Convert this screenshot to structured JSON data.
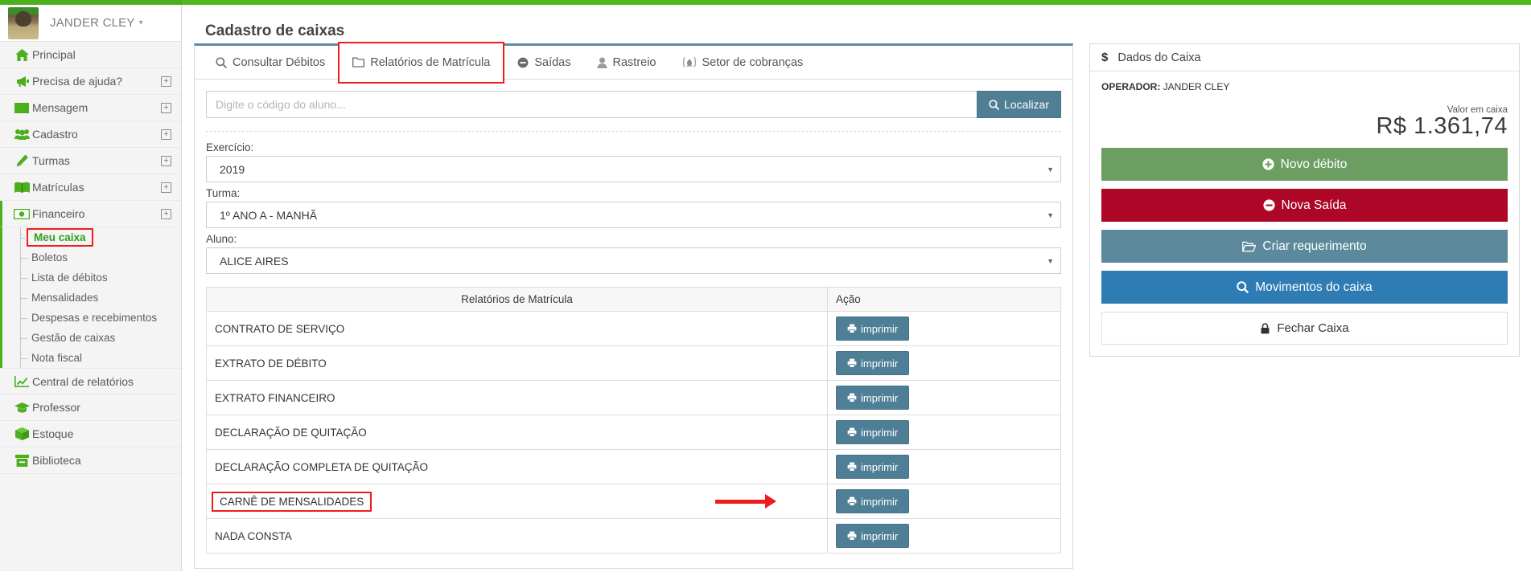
{
  "sidebar": {
    "user": {
      "name": "JANDER CLEY",
      "caret": "caret-down-icon"
    },
    "items": [
      {
        "label": "Principal",
        "icon": "home-icon",
        "expandable": false
      },
      {
        "label": "Precisa de ajuda?",
        "icon": "megaphone-icon",
        "expandable": true
      },
      {
        "label": "Mensagem",
        "icon": "envelope-icon",
        "expandable": true
      },
      {
        "label": "Cadastro",
        "icon": "users-icon",
        "expandable": true
      },
      {
        "label": "Turmas",
        "icon": "pencil-icon",
        "expandable": true
      },
      {
        "label": "Matrículas",
        "icon": "book-icon",
        "expandable": true
      },
      {
        "label": "Financeiro",
        "icon": "money-icon",
        "expandable": true,
        "active": true
      },
      {
        "label": "Central de relatórios",
        "icon": "chart-line-icon",
        "expandable": false
      },
      {
        "label": "Professor",
        "icon": "graduation-icon",
        "expandable": false
      },
      {
        "label": "Estoque",
        "icon": "box-icon",
        "expandable": false
      },
      {
        "label": "Biblioteca",
        "icon": "archive-icon",
        "expandable": false
      }
    ],
    "financeiro_children": [
      {
        "label": "Meu caixa",
        "highlighted": true
      },
      {
        "label": "Boletos",
        "highlighted": false
      },
      {
        "label": "Lista de débitos",
        "highlighted": false
      },
      {
        "label": "Mensalidades",
        "highlighted": false
      },
      {
        "label": "Despesas e recebimentos",
        "highlighted": false
      },
      {
        "label": "Gestão de caixas",
        "highlighted": false
      },
      {
        "label": "Nota fiscal",
        "highlighted": false
      }
    ],
    "expand_glyph": "+"
  },
  "page": {
    "title": "Cadastro de caixas"
  },
  "tabs": [
    {
      "label": "Consultar Débitos",
      "icon": "search-icon",
      "active": false,
      "highlighted": false
    },
    {
      "label": "Relatórios de Matrícula",
      "icon": "folder-icon",
      "active": true,
      "highlighted": true
    },
    {
      "label": "Saídas",
      "icon": "minus-circle-icon",
      "active": false,
      "highlighted": false
    },
    {
      "label": "Rastreio",
      "icon": "user-icon",
      "active": false,
      "highlighted": false
    },
    {
      "label": "Setor de cobranças",
      "icon": "fire-icon",
      "active": false,
      "highlighted": false
    }
  ],
  "search": {
    "placeholder": "Digite o código do aluno...",
    "value": "",
    "button_label": "Localizar",
    "button_icon": "search-icon"
  },
  "filters": [
    {
      "label": "Exercício:",
      "value": "2019",
      "name": "exercicio"
    },
    {
      "label": "Turma:",
      "value": "1º ANO A - MANHÃ",
      "name": "turma"
    },
    {
      "label": "Aluno:",
      "value": "ALICE AIRES",
      "name": "aluno"
    }
  ],
  "table": {
    "headers": {
      "name": "Relatórios de Matrícula",
      "action": "Ação"
    },
    "print_label": "imprimir",
    "print_icon": "printer-icon",
    "rows": [
      {
        "name": "CONTRATO DE SERVIÇO",
        "highlighted": false,
        "arrow": false
      },
      {
        "name": "EXTRATO DE DÉBITO",
        "highlighted": false,
        "arrow": false
      },
      {
        "name": "EXTRATO FINANCEIRO",
        "highlighted": false,
        "arrow": false
      },
      {
        "name": "DECLARAÇÃO DE QUITAÇÃO",
        "highlighted": false,
        "arrow": false
      },
      {
        "name": "DECLARAÇÃO COMPLETA DE QUITAÇÃO",
        "highlighted": false,
        "arrow": false
      },
      {
        "name": "CARNÊ DE MENSALIDADES",
        "highlighted": true,
        "arrow": true
      },
      {
        "name": "NADA CONSTA",
        "highlighted": false,
        "arrow": false
      }
    ]
  },
  "cash_panel": {
    "icon": "dollar-icon",
    "title": "Dados do Caixa",
    "operator_label": "OPERADOR:",
    "operator_name": " JANDER CLEY",
    "balance_label": "Valor em caixa",
    "balance_value": "R$ 1.361,74",
    "buttons": [
      {
        "label": "Novo débito",
        "icon": "plus-circle-icon",
        "style": "green"
      },
      {
        "label": "Nova Saída",
        "icon": "minus-circle-icon",
        "style": "red"
      },
      {
        "label": "Criar requerimento",
        "icon": "folder-open-icon",
        "style": "teal"
      },
      {
        "label": "Movimentos do caixa",
        "icon": "search-icon",
        "style": "blue"
      },
      {
        "label": "Fechar Caixa",
        "icon": "lock-icon",
        "style": "white"
      }
    ]
  },
  "colors": {
    "brand_green": "#4caf1e",
    "accent_blue": "#4e7f96",
    "annotation_red": "#ee1c1c",
    "btn_green": "#6c9e62",
    "btn_red": "#ad0626",
    "btn_teal": "#5c8a9c",
    "btn_blue": "#2f7cb5"
  }
}
